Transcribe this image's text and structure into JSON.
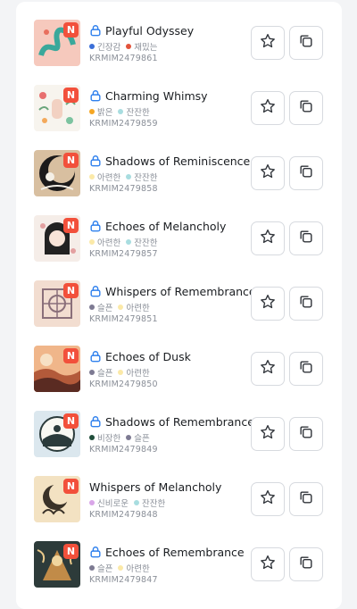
{
  "items": [
    {
      "title": "Playful Odyssey",
      "code": "KRMIM2479861",
      "badge": "N",
      "lock_icon": "lock-icon",
      "art": "serpent",
      "tags": [
        {
          "label": "긴장감",
          "color": "#3b6fd8"
        },
        {
          "label": "재밌는",
          "color": "#e2533b"
        }
      ]
    },
    {
      "title": "Charming Whimsy",
      "code": "KRMIM2479859",
      "badge": "N",
      "lock_icon": "lock-icon",
      "art": "floral",
      "tags": [
        {
          "label": "밝은",
          "color": "#f5a623"
        },
        {
          "label": "잔잔한",
          "color": "#a8dde0"
        }
      ]
    },
    {
      "title": "Shadows of Reminiscence",
      "code": "KRMIM2479858",
      "badge": "N",
      "lock_icon": "lock-icon",
      "art": "moon",
      "tags": [
        {
          "label": "아련한",
          "color": "#fbe9a8"
        },
        {
          "label": "잔잔한",
          "color": "#a8dde0"
        }
      ]
    },
    {
      "title": "Echoes of Melancholy",
      "code": "KRMIM2479857",
      "badge": "N",
      "lock_icon": "lock-icon",
      "art": "girl",
      "tags": [
        {
          "label": "아련한",
          "color": "#fbe9a8"
        },
        {
          "label": "잔잔한",
          "color": "#a8dde0"
        }
      ]
    },
    {
      "title": "Whispers of Remembrance",
      "code": "KRMIM2479851",
      "badge": "N",
      "lock_icon": "lock-icon",
      "art": "mandala",
      "tags": [
        {
          "label": "슬픈",
          "color": "#7d7a92"
        },
        {
          "label": "아련한",
          "color": "#fbe9a8"
        }
      ]
    },
    {
      "title": "Echoes of Dusk",
      "code": "KRMIM2479850",
      "badge": "N",
      "lock_icon": "lock-icon",
      "art": "dusk",
      "tags": [
        {
          "label": "슬픈",
          "color": "#7d7a92"
        },
        {
          "label": "아련한",
          "color": "#fbe9a8"
        }
      ]
    },
    {
      "title": "Shadows of Remembrance",
      "code": "KRMIM2479849",
      "badge": "N",
      "lock_icon": "lock-icon",
      "art": "circle",
      "tags": [
        {
          "label": "비장한",
          "color": "#1f4d3a"
        },
        {
          "label": "슬픈",
          "color": "#7d7a92"
        }
      ]
    },
    {
      "title": "Whispers of Melancholy",
      "code": "KRMIM2479848",
      "badge": "N",
      "lock_icon": "",
      "art": "crescent",
      "tags": [
        {
          "label": "신비로운",
          "color": "#d9a6e8"
        },
        {
          "label": "잔잔한",
          "color": "#a8dde0"
        }
      ]
    },
    {
      "title": "Echoes of Remembrance",
      "code": "KRMIM2479847",
      "badge": "N",
      "lock_icon": "lock-icon",
      "art": "dark",
      "tags": [
        {
          "label": "슬픈",
          "color": "#7d7a92"
        },
        {
          "label": "아련한",
          "color": "#fbe9a8"
        }
      ]
    }
  ],
  "colors": {
    "badge": "#f2503b",
    "lock": "#2f80ed",
    "accent_text": "#8a8f98"
  }
}
